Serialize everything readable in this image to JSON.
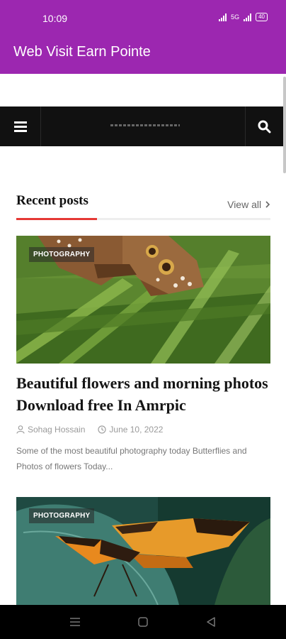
{
  "status": {
    "time": "10:09",
    "network": "5G",
    "battery": "40"
  },
  "app": {
    "title": "Web Visit Earn Pointe"
  },
  "section": {
    "title": "Recent posts",
    "view_all": "View all"
  },
  "posts": [
    {
      "category": "PHOTOGRAPHY",
      "title": "Beautiful flowers and morning photos Download free In Amrpic",
      "author": "Sohag Hossain",
      "date": "June 10, 2022",
      "excerpt": "Some of the most beautiful photography today  Butterflies and Photos of flowers Today..."
    },
    {
      "category": "PHOTOGRAPHY"
    }
  ],
  "colors": {
    "app_bar": "#9c27b0",
    "accent": "#e53935",
    "header_bg": "#111111"
  },
  "icons": [
    "hamburger-icon",
    "search-icon",
    "user-icon",
    "clock-icon",
    "chevron-right-icon"
  ]
}
